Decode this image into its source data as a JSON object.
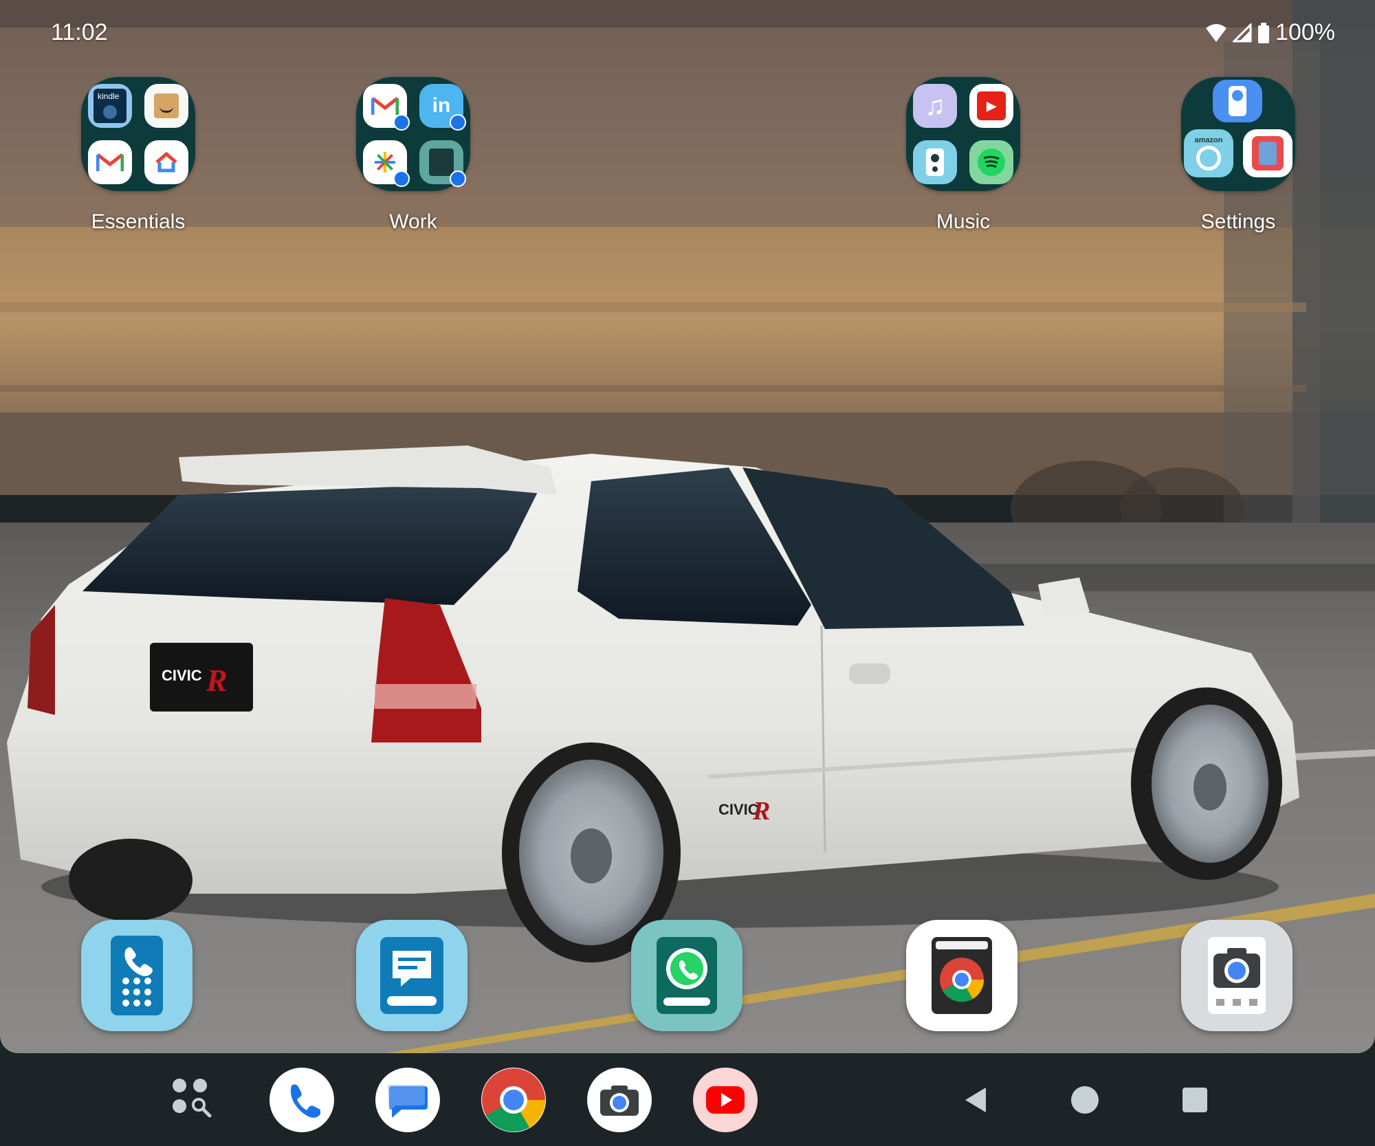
{
  "status_bar": {
    "time": "11:02",
    "battery": "100%"
  },
  "folders": [
    {
      "label": "Essentials",
      "apps": [
        "kindle-icon",
        "amazon-shopping-icon",
        "gmail-icon",
        "google-home-icon"
      ]
    },
    {
      "label": "Work",
      "apps": [
        "gmail-work-icon",
        "linkedin-work-icon",
        "photos-work-icon",
        "notes-work-icon"
      ]
    },
    {
      "label": "Music",
      "apps": [
        "apple-music-icon",
        "youtube-music-icon",
        "speaker-remote-icon",
        "spotify-icon"
      ]
    },
    {
      "label": "Settings",
      "apps": [
        "settings-remote-icon",
        "amazon-alexa-icon",
        "shortcut-settings-icon"
      ]
    }
  ],
  "kindle_text": "kindle",
  "amazon_text": "amazon",
  "favorites": [
    "phone-app",
    "messages-app",
    "whatsapp-app",
    "chrome-app",
    "camera-app"
  ],
  "taskbar": [
    "app-drawer",
    "phone",
    "messages",
    "chrome",
    "camera",
    "youtube"
  ],
  "nav": [
    "back",
    "home",
    "recents"
  ],
  "colors": {
    "folder_bg": "#0d3a3b",
    "taskbar_bg": "#1d2427",
    "accent_blue": "#1a73e8"
  }
}
